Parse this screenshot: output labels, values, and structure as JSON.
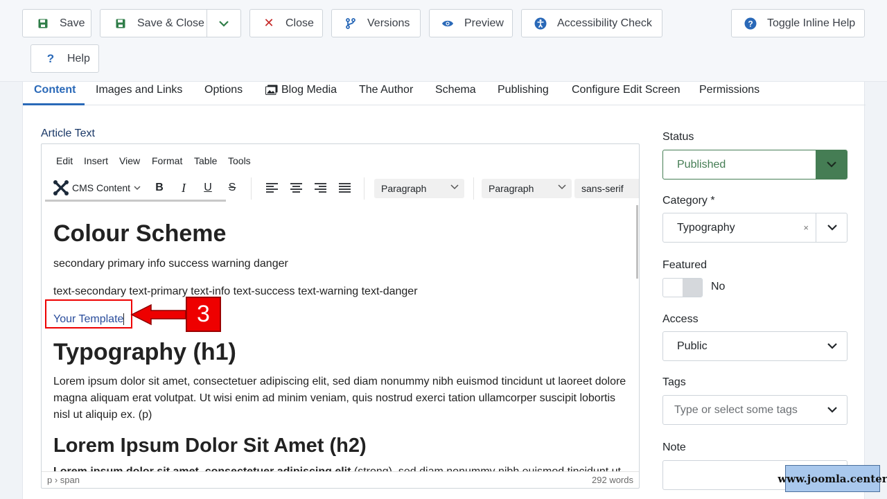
{
  "toolbar": {
    "save": "Save",
    "save_close": "Save & Close",
    "close": "Close",
    "versions": "Versions",
    "preview": "Preview",
    "accessibility": "Accessibility Check",
    "toggle_help": "Toggle Inline Help",
    "help": "Help"
  },
  "tabs": [
    "Content",
    "Images and Links",
    "Options",
    "Blog Media",
    "The Author",
    "Schema",
    "Publishing",
    "Configure Edit Screen",
    "Permissions"
  ],
  "article_text_label": "Article Text",
  "editor": {
    "menu": [
      "Edit",
      "Insert",
      "View",
      "Format",
      "Table",
      "Tools"
    ],
    "cms_content": "CMS Content",
    "block_select": "Paragraph",
    "font_select": "Paragraph",
    "font_family": "sans-serif",
    "content": {
      "h1": "Colour Scheme",
      "line1": "secondary primary info success warning danger",
      "line2": "text-secondary text-primary text-info text-success text-warning text-danger",
      "link": "Your Template",
      "h1b": "Typography (h1)",
      "para": "Lorem ipsum dolor sit amet, consectetuer adipiscing elit, sed diam nonummy nibh euismod tincidunt ut laoreet dolore magna aliquam erat volutpat. Ut wisi enim ad minim veniam, quis nostrud exerci tation ullamcorper suscipit lobortis nisl ut aliquip ex. (p)",
      "h2": "Lorem Ipsum Dolor Sit Amet (h2)",
      "strong": "Lorem ipsum dolor sit amet, consectetuer adipiscing elit",
      "after_strong": " (strong), sed diam nonummy nibh euismod tincidunt ut"
    },
    "path": "p › span",
    "word_count": "292 words"
  },
  "callout_number": "3",
  "sidebar": {
    "status_label": "Status",
    "status_value": "Published",
    "category_label": "Category *",
    "category_value": "Typography",
    "featured_label": "Featured",
    "featured_value": "No",
    "access_label": "Access",
    "access_value": "Public",
    "tags_label": "Tags",
    "tags_placeholder": "Type or select some tags",
    "note_label": "Note"
  },
  "watermark": "www.joomla.center",
  "colors": {
    "primary_blue": "#2a69b8",
    "published_green": "#457d54",
    "callout_red": "#e00"
  }
}
